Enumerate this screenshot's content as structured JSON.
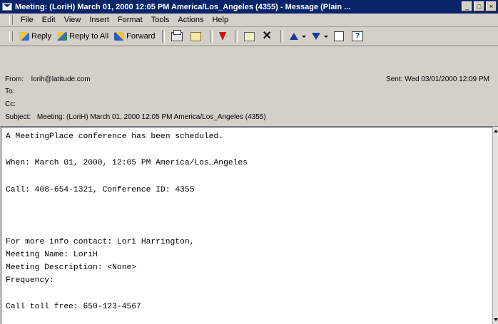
{
  "window": {
    "title": "Meeting: (LoriH) March 01, 2000 12:05 PM America/Los_Angeles (4355) - Message (Plain ...",
    "controls": [
      "_",
      "□",
      "×"
    ]
  },
  "menu": {
    "items": [
      "File",
      "Edit",
      "View",
      "Insert",
      "Format",
      "Tools",
      "Actions",
      "Help"
    ]
  },
  "toolbar": {
    "reply": "Reply",
    "reply_all": "Reply to All",
    "forward": "Forward",
    "help_glyph": "?"
  },
  "header": {
    "from_label": "From:",
    "from_value": "lorih@latitude.com",
    "to_label": "To:",
    "cc_label": "Cc:",
    "subject_label": "Subject:",
    "subject_value": "Meeting: (LoriH) March 01, 2000 12:05 PM America/Los_Angeles (4355)",
    "sent_label": "Sent:",
    "sent_value": "Wed 03/01/2000 12:09 PM"
  },
  "body": {
    "lines": [
      "A MeetingPlace conference has been scheduled.",
      "When: March 01, 2000, 12:05 PM America/Los_Angeles",
      "Call: 408-654-1321, Conference ID: 4355",
      "For more info contact: Lori Harrington,",
      "Meeting Name: LoriH",
      "Meeting Description: <None>",
      "Frequency:",
      "Call toll free: 650-123-4567"
    ]
  },
  "colors": {
    "titlebar": "#0a246a",
    "chrome": "#d4d0c8",
    "body_bg": "#ffffff"
  },
  "icons": [
    "envelope-icon",
    "reply-icon",
    "reply-all-icon",
    "forward-icon",
    "print-icon",
    "move-icon",
    "flag-icon",
    "contact-icon",
    "delete-icon",
    "previous-item-icon",
    "next-item-icon",
    "address-book-icon",
    "help-icon"
  ]
}
